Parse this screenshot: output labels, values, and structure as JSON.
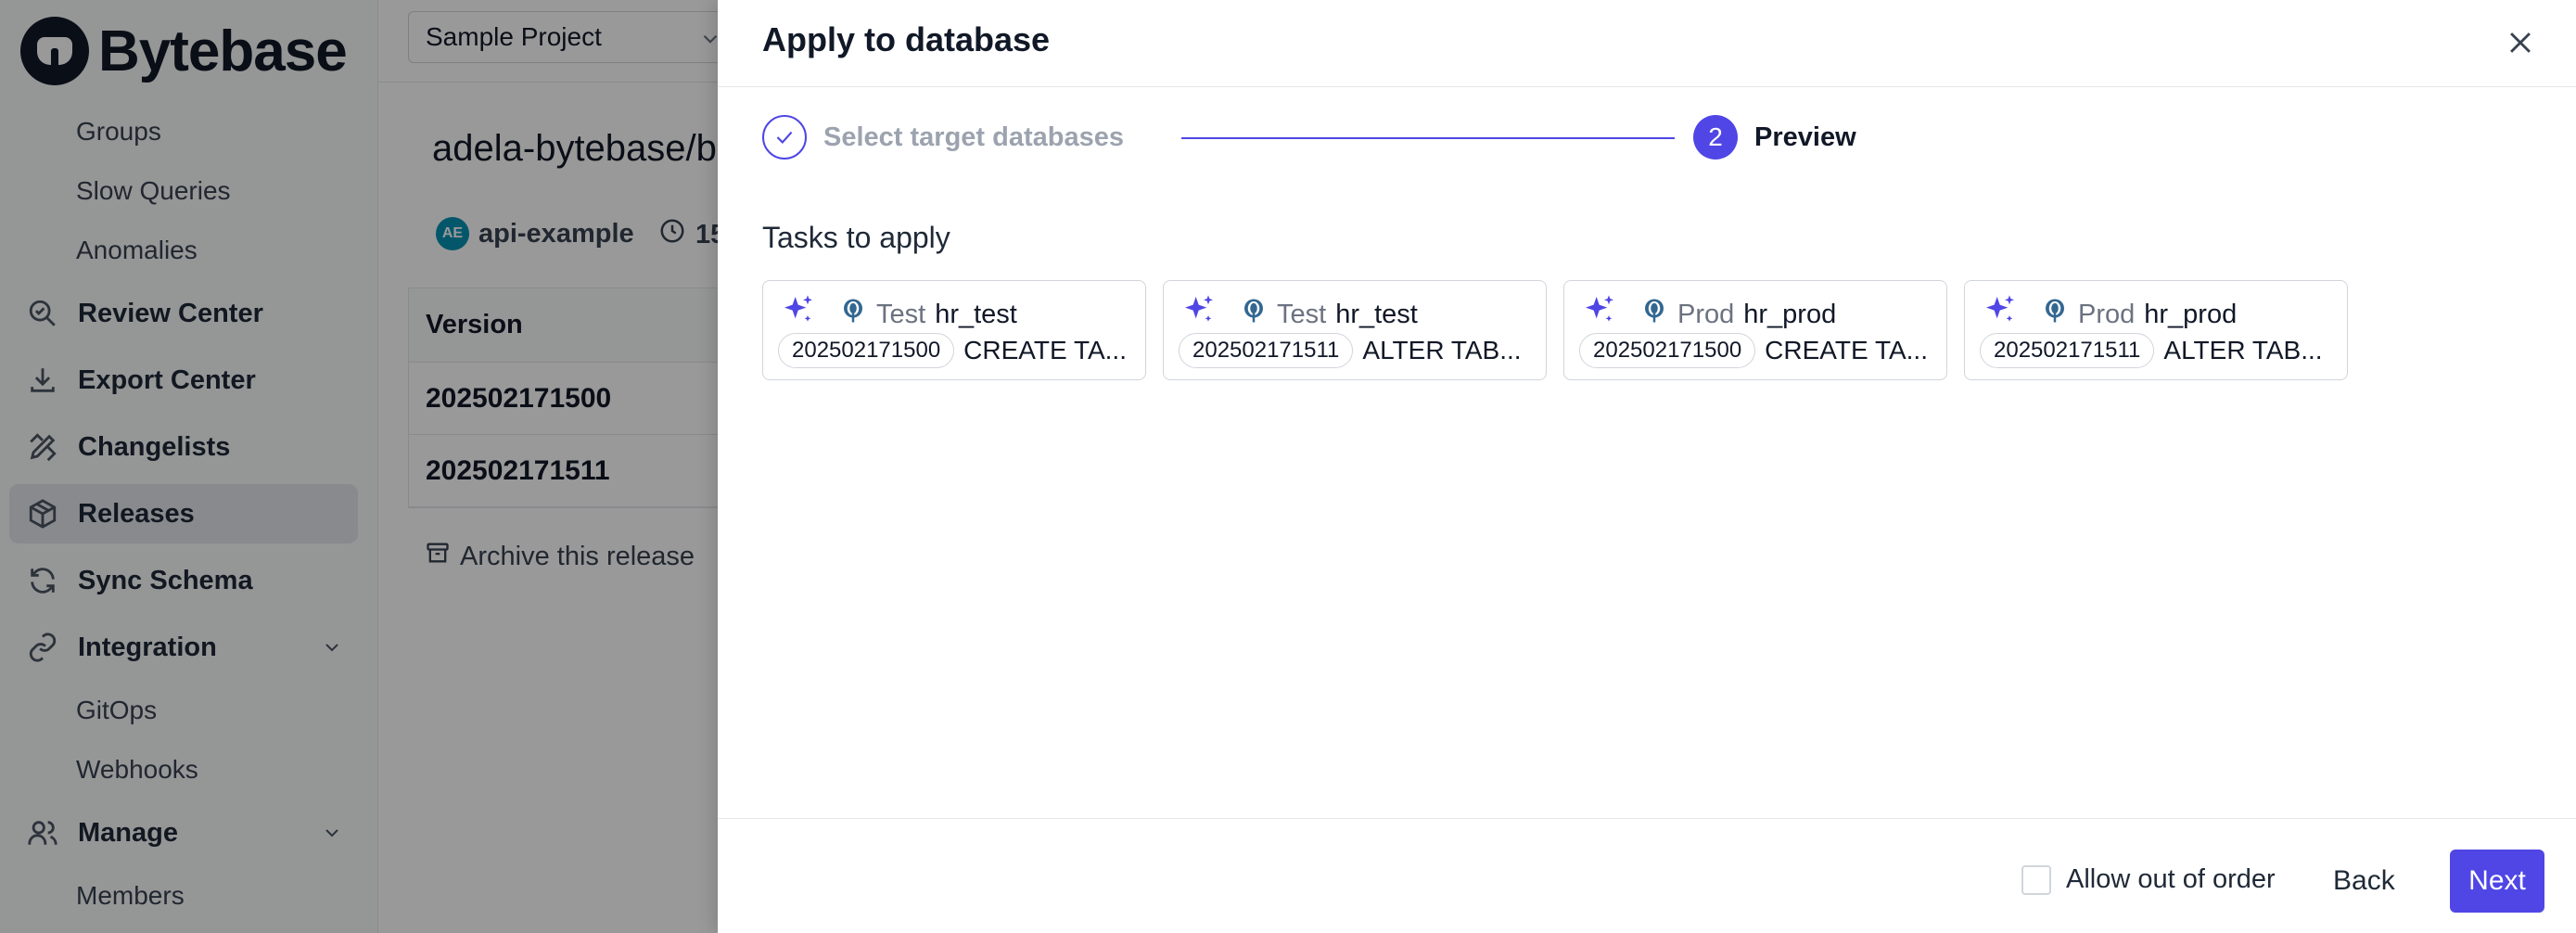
{
  "sidebar": {
    "brand": "Bytebase",
    "sub_items_top": [
      "Groups",
      "Slow Queries",
      "Anomalies"
    ],
    "items": [
      {
        "label": "Review Center",
        "icon": "search-check-icon"
      },
      {
        "label": "Export Center",
        "icon": "download-icon"
      },
      {
        "label": "Changelists",
        "icon": "pencil-ruler-icon"
      },
      {
        "label": "Releases",
        "icon": "package-icon",
        "active": true
      },
      {
        "label": "Sync Schema",
        "icon": "refresh-icon"
      },
      {
        "label": "Integration",
        "icon": "link-icon",
        "expandable": true
      },
      {
        "label": "Manage",
        "icon": "users-icon",
        "expandable": true
      }
    ],
    "integration_sub": [
      "GitOps",
      "Webhooks"
    ],
    "manage_sub": [
      "Members"
    ]
  },
  "header": {
    "project_selector": "Sample Project"
  },
  "release": {
    "title": "adela-bytebase/b",
    "creator": "api-example",
    "creator_initials": "AE",
    "time_prefix": "15",
    "table_header": "Version",
    "versions": [
      "202502171500",
      "202502171511"
    ],
    "archive_label": "Archive this release"
  },
  "drawer": {
    "title": "Apply to database",
    "steps": [
      {
        "label": "Select target databases",
        "status": "done"
      },
      {
        "number": "2",
        "label": "Preview",
        "status": "current"
      }
    ],
    "tasks_title": "Tasks to apply",
    "tasks": [
      {
        "env": "Test",
        "db": "hr_test",
        "version": "202502171500",
        "statement": "CREATE TA..."
      },
      {
        "env": "Test",
        "db": "hr_test",
        "version": "202502171511",
        "statement": "ALTER TAB..."
      },
      {
        "env": "Prod",
        "db": "hr_prod",
        "version": "202502171500",
        "statement": "CREATE TA..."
      },
      {
        "env": "Prod",
        "db": "hr_prod",
        "version": "202502171511",
        "statement": "ALTER TAB..."
      }
    ],
    "allow_out_of_order_label": "Allow out of order",
    "allow_out_of_order_checked": false,
    "back_label": "Back",
    "next_label": "Next"
  },
  "colors": {
    "accent": "#4f46e5",
    "sparkle": "#4f46e5",
    "overlay": "rgba(0,0,0,0.40)"
  }
}
